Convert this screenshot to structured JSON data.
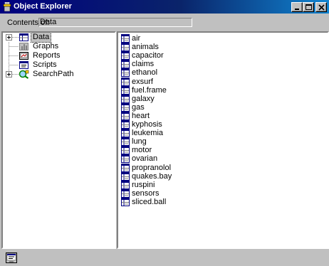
{
  "window": {
    "title": "Object Explorer"
  },
  "title_buttons": {
    "minimize": "minimize",
    "maximize": "maximize",
    "close": "close"
  },
  "contents": {
    "label": "Contents of:",
    "value": "Data"
  },
  "tree": {
    "items": [
      {
        "label": "Data",
        "icon": "data-grid-icon",
        "expandable": true,
        "selected": true
      },
      {
        "label": "Graphs",
        "icon": "graph-icon",
        "expandable": false,
        "selected": false
      },
      {
        "label": "Reports",
        "icon": "report-icon",
        "expandable": false,
        "selected": false
      },
      {
        "label": "Scripts",
        "icon": "script-icon",
        "expandable": false,
        "selected": false
      },
      {
        "label": "SearchPath",
        "icon": "search-path-icon",
        "expandable": true,
        "selected": false
      }
    ]
  },
  "list": {
    "icon": "dataframe-icon",
    "items": [
      "air",
      "animals",
      "capacitor",
      "claims",
      "ethanol",
      "exsurf",
      "fuel.frame",
      "galaxy",
      "gas",
      "heart",
      "kyphosis",
      "leukemia",
      "lung",
      "motor",
      "ovarian",
      "propranolol",
      "quakes.bay",
      "ruspini",
      "sensors",
      "sliced.ball"
    ]
  },
  "colors": {
    "titlebar_start": "#000080",
    "titlebar_end": "#1084d0",
    "face": "#c0c0c0"
  }
}
